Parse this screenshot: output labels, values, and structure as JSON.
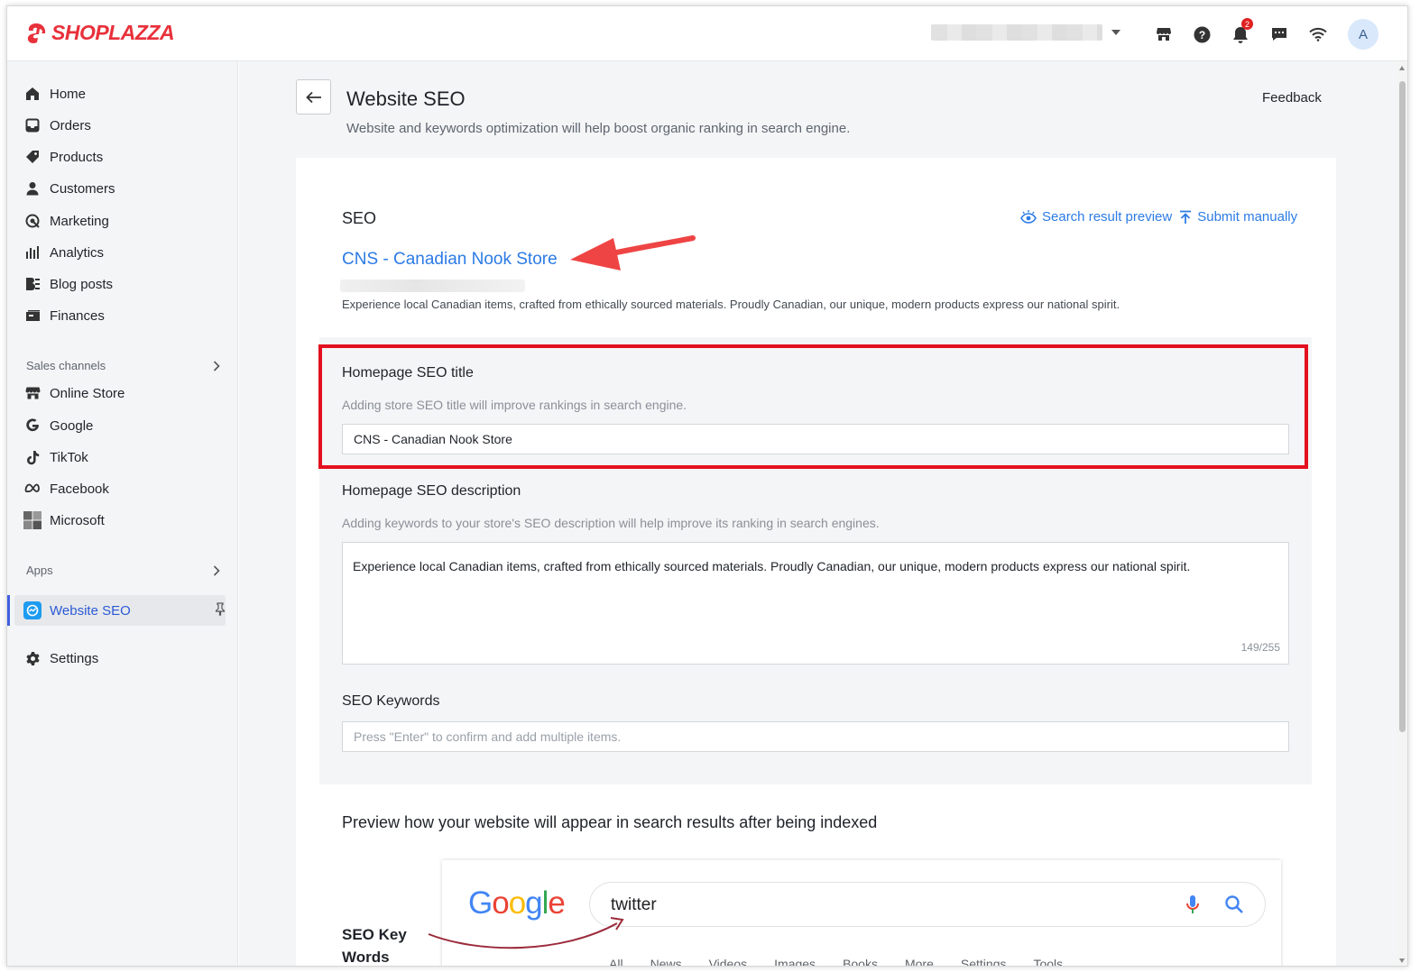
{
  "brand": {
    "name": "SHOPLAZZA",
    "color": "#e8313b"
  },
  "topbar": {
    "notification_count": "2",
    "avatar_initial": "A",
    "icons": [
      "store-icon",
      "help-icon",
      "bell-icon",
      "message-icon",
      "wifi-icon"
    ]
  },
  "sidebar": {
    "main_items": [
      {
        "label": "Home",
        "icon": "home-icon"
      },
      {
        "label": "Orders",
        "icon": "orders-icon"
      },
      {
        "label": "Products",
        "icon": "tag-icon"
      },
      {
        "label": "Customers",
        "icon": "person-icon"
      },
      {
        "label": "Marketing",
        "icon": "marketing-icon"
      },
      {
        "label": "Analytics",
        "icon": "bar-chart-icon"
      },
      {
        "label": "Blog posts",
        "icon": "blog-icon"
      },
      {
        "label": "Finances",
        "icon": "finances-icon"
      }
    ],
    "sales_channels_label": "Sales channels",
    "channels": [
      {
        "label": "Online Store",
        "icon": "store-icon"
      },
      {
        "label": "Google",
        "icon": "google-icon"
      },
      {
        "label": "TikTok",
        "icon": "tiktok-icon"
      },
      {
        "label": "Facebook",
        "icon": "meta-icon"
      },
      {
        "label": "Microsoft",
        "icon": "microsoft-icon"
      }
    ],
    "apps_label": "Apps",
    "active_app": {
      "label": "Website SEO",
      "icon": "website-seo-icon"
    },
    "settings_label": "Settings"
  },
  "page": {
    "title": "Website SEO",
    "subtitle": "Website and keywords optimization will help boost organic ranking in search engine.",
    "feedback_label": "Feedback"
  },
  "seo": {
    "section_label": "SEO",
    "search_result_preview": "Search result preview",
    "submit_manually": "Submit manually",
    "snippet_title": "CNS - Canadian Nook Store",
    "snippet_description": "Experience local Canadian items, crafted from ethically sourced materials. Proudly Canadian, our unique, modern products express our national spirit."
  },
  "form": {
    "title_label": "Homepage SEO title",
    "title_help": "Adding store SEO title will improve rankings in search engine.",
    "title_value": "CNS - Canadian Nook Store",
    "description_label": "Homepage SEO description",
    "description_help": "Adding keywords to your store's SEO description will help improve its ranking in search engines.",
    "description_value": "Experience local Canadian items, crafted from ethically sourced materials. Proudly Canadian, our unique, modern products express our national spirit.",
    "description_counter": "149/255",
    "keywords_label": "SEO Keywords",
    "keywords_placeholder": "Press \"Enter\" to confirm and add multiple items."
  },
  "preview": {
    "heading": "Preview how your website will appear in search results after being indexed",
    "google_letters": [
      "G",
      "o",
      "o",
      "g",
      "l",
      "e"
    ],
    "google_colors": [
      "#4285f4",
      "#ea4335",
      "#fbbc05",
      "#4285f4",
      "#34a853",
      "#ea4335"
    ],
    "query": "twitter",
    "tabs": [
      "All",
      "News",
      "Videos",
      "Images",
      "Books",
      "More",
      "Settings",
      "Tools"
    ],
    "keyword_annotation_line1": "SEO Key",
    "keyword_annotation_line2": "Words"
  },
  "colors": {
    "accent": "#2c7be5",
    "highlight_border": "#e3101e",
    "annotation_arrow": "#ef4444"
  }
}
